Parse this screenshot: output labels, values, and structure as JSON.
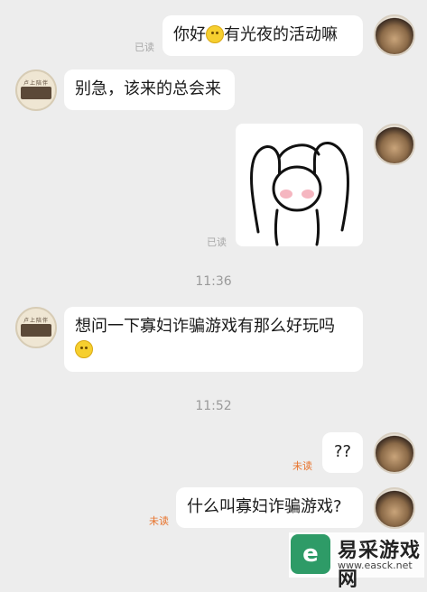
{
  "messages": {
    "m1": {
      "text_a": "你好",
      "emoji": "smiley-emoji",
      "text_b": "有光夜的活动嘛",
      "status": "已读"
    },
    "m2": {
      "text": "别急，该来的总会来"
    },
    "m3": {
      "status": "已读"
    },
    "time1": "11:36",
    "m4": {
      "text": "想问一下寡妇诈骗游戏有那么好玩吗",
      "emoji": "thinking-emoji"
    },
    "time2": "11:52",
    "m5": {
      "text": "??",
      "status": "未读"
    },
    "m6": {
      "text": "什么叫寡妇诈骗游戏?",
      "status": "未读"
    }
  },
  "avatar_left_text": "卢上陪伴",
  "watermark": {
    "logo": "e",
    "title": "易采游戏网",
    "url": "www.easck.net"
  },
  "colors": {
    "background": "#ededed",
    "bubble": "#ffffff",
    "unread": "#e8732c",
    "read": "#a8a8a8"
  }
}
